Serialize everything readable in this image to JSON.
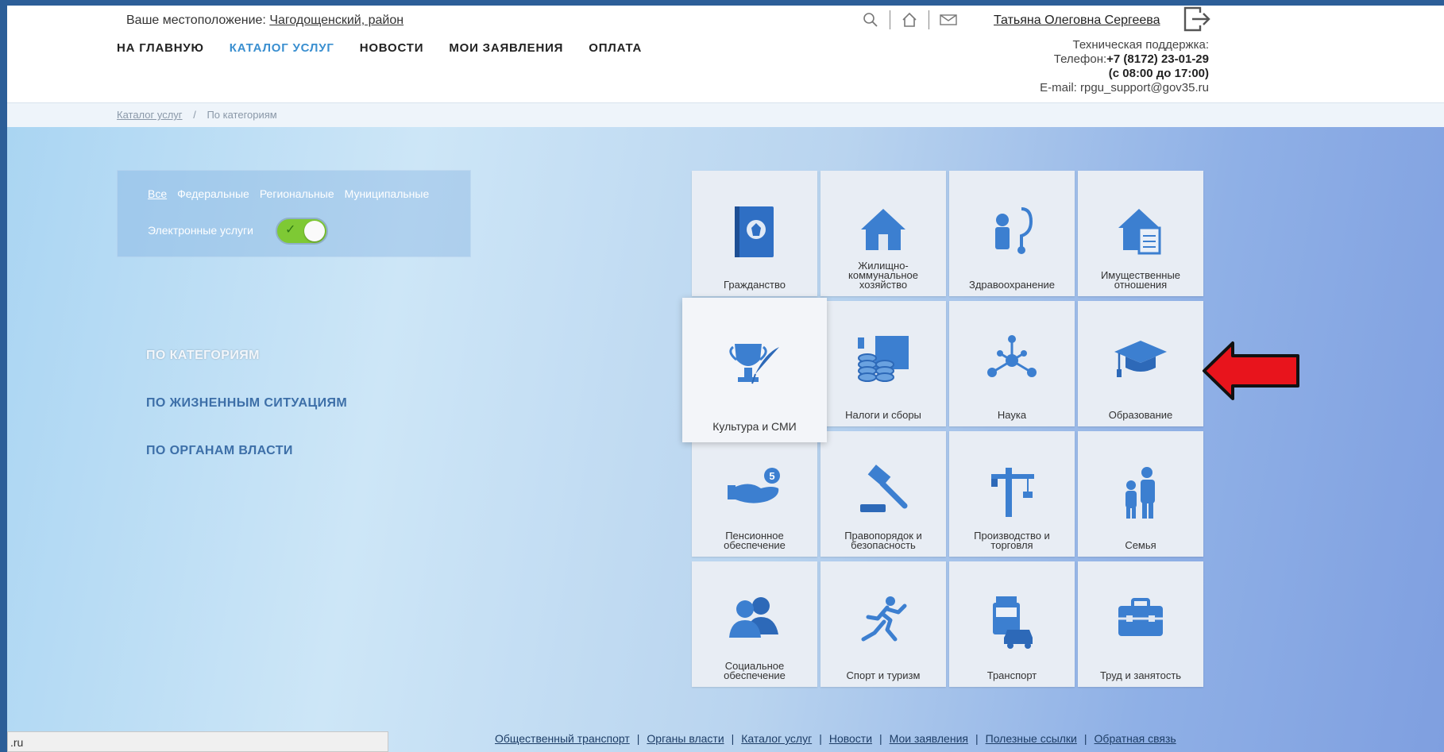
{
  "header": {
    "location_label": "Ваше местоположение:",
    "location_value": "Чагодощенский, район",
    "nav": [
      "НА ГЛАВНУЮ",
      "КАТАЛОГ УСЛУГ",
      "НОВОСТИ",
      "МОИ ЗАЯВЛЕНИЯ",
      "ОПЛАТА"
    ],
    "active_nav": "КАТАЛОГ УСЛУГ",
    "tool_icons": [
      "search-icon",
      "home-icon",
      "mail-icon"
    ],
    "user_name": "Татьяна Олеговна Сергеева",
    "support": {
      "title": "Техническая поддержка:",
      "phone_label": "Телефон:",
      "phone": "+7 (8172) 23-01-29",
      "hours": "(с 08:00 до 17:00)",
      "email": "E-mail: rpgu_support@gov35.ru"
    }
  },
  "breadcrumb": {
    "root": "Каталог услуг",
    "separator": "/",
    "current": "По категориям"
  },
  "filter": {
    "tabs": [
      "Все",
      "Федеральные",
      "Региональные",
      "Муниципальные"
    ],
    "selected_tab": "Все",
    "toggle_label": "Электронные услуги",
    "toggle_on": true
  },
  "sidenav": [
    "ПО КАТЕГОРИЯМ",
    "ПО ЖИЗНЕННЫМ СИТУАЦИЯМ",
    "ПО ОРГАНАМ ВЛАСТИ"
  ],
  "tiles": [
    {
      "label": "Гражданство",
      "icon": "passport-icon"
    },
    {
      "label": "Жилищно-коммунальное хозяйство",
      "icon": "house-icon"
    },
    {
      "label": "Здравоохранение",
      "icon": "stethoscope-icon"
    },
    {
      "label": "Имущественные отношения",
      "icon": "property-icon"
    },
    {
      "label": "Культура и СМИ",
      "icon": "trophy-quill-icon"
    },
    {
      "label": "Налоги и сборы",
      "icon": "coins-icon"
    },
    {
      "label": "Наука",
      "icon": "molecule-icon"
    },
    {
      "label": "Образование",
      "icon": "graduation-cap-icon"
    },
    {
      "label": "Пенсионное обеспечение",
      "icon": "pension-hand-icon"
    },
    {
      "label": "Правопорядок и безопасность",
      "icon": "gavel-icon"
    },
    {
      "label": "Производство и торговля",
      "icon": "crane-icon"
    },
    {
      "label": "Семья",
      "icon": "family-icon"
    },
    {
      "label": "Социальное обеспечение",
      "icon": "people-icon"
    },
    {
      "label": "Спорт и туризм",
      "icon": "runner-icon"
    },
    {
      "label": "Транспорт",
      "icon": "transport-icon"
    },
    {
      "label": "Труд и занятость",
      "icon": "briefcase-icon"
    }
  ],
  "footer_links": [
    "Общественный транспорт",
    "Органы власти",
    "Каталог услуг",
    "Новости",
    "Мои заявления",
    "Полезные ссылки",
    "Обратная связь"
  ],
  "status_bar": ".ru",
  "colors": {
    "accent": "#3a8fd0",
    "icon_blue": "#3c7fd0",
    "arrow": "#e8141c"
  }
}
